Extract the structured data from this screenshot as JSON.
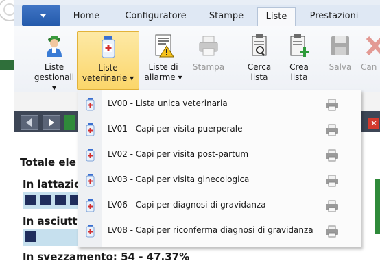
{
  "ribbon_tabs": [
    {
      "label": "Home"
    },
    {
      "label": "Configuratore"
    },
    {
      "label": "Stampe"
    },
    {
      "label": "Liste",
      "active": true
    },
    {
      "label": "Prestazioni"
    }
  ],
  "ribbon_buttons": {
    "liste_gestionali": {
      "line1": "Liste",
      "line2": "gestionali ▾"
    },
    "liste_veterinarie": {
      "line1": "Liste",
      "line2": "veterinarie ▾"
    },
    "liste_di_allarme": {
      "line1": "Liste di",
      "line2": "allarme ▾"
    },
    "stampa": {
      "line1": "Stampa",
      "line2": ""
    },
    "cerca_lista": {
      "line1": "Cerca",
      "line2": "lista"
    },
    "crea_lista": {
      "line1": "Crea",
      "line2": "lista"
    },
    "salva": {
      "line1": "Salva",
      "line2": ""
    },
    "cancella": {
      "line1": "Can",
      "line2": ""
    }
  },
  "content": {
    "totale_label": "Totale ele",
    "in_lattazione_label": "In lattazio",
    "in_asciutta_label": "In asciutta",
    "bottom_text": "In svezzamento: 54 - 47.37%",
    "lattazione_squares": 4,
    "asciutta_squares": 1
  },
  "dropdown": {
    "items": [
      {
        "label": "LV00 - Lista unica veterinaria"
      },
      {
        "label": "LV01 - Capi per visita puerperale"
      },
      {
        "label": "LV02 - Capi per visita post-partum"
      },
      {
        "label": "LV03 - Capi per visita ginecologica"
      },
      {
        "label": "LV06 - Capi per diagnosi di gravidanza"
      },
      {
        "label": "LV08 - Capi per riconferma diagnosi di gravidanza"
      }
    ]
  },
  "colors": {
    "accent_blue": "#245aab",
    "selected_button": "#fbd66a",
    "dark_toolbar": "#3d4656",
    "bar_fill": "#c6e0ee",
    "square_fill": "#1f2d5c",
    "close_red": "#d23a2e"
  },
  "icons": [
    "farmer-icon",
    "medicine-bottle-icon",
    "alarm-list-icon",
    "printer-icon",
    "search-list-icon",
    "create-list-icon",
    "save-icon",
    "delete-icon"
  ]
}
